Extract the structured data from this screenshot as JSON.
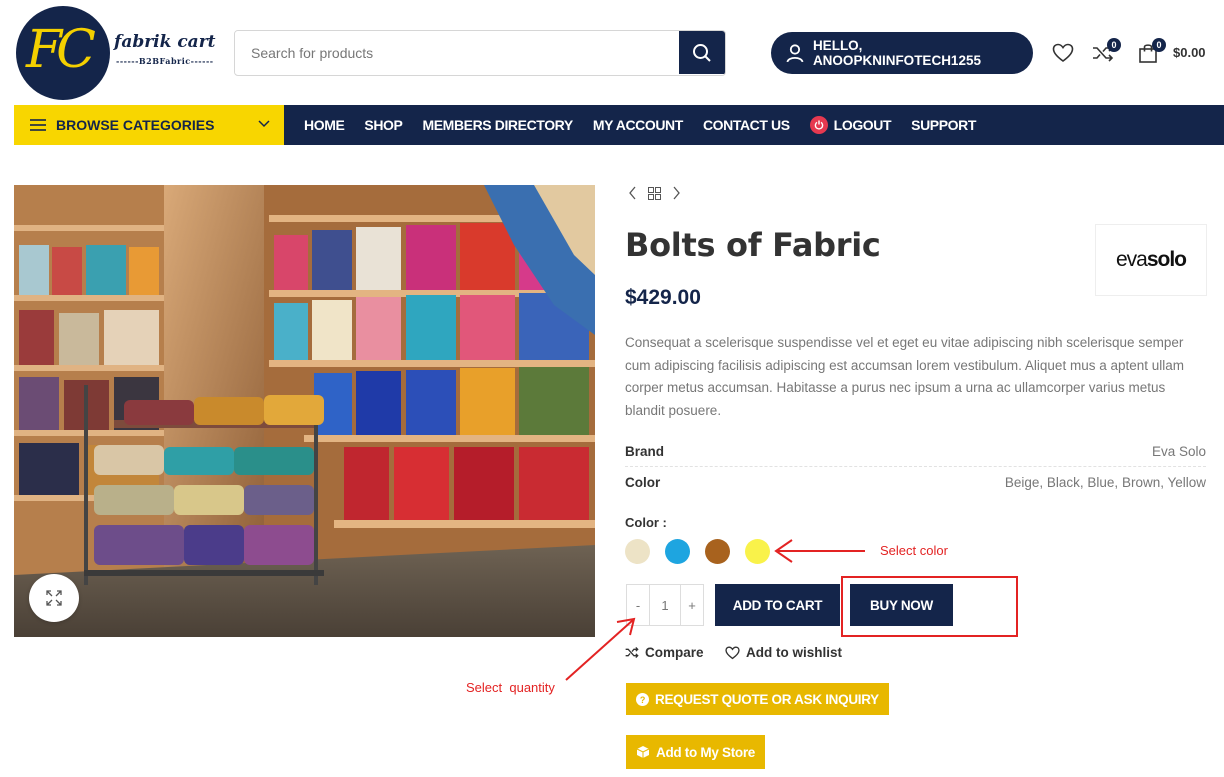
{
  "header": {
    "logo_initials": "FC",
    "logo_name": "fabrik cart",
    "logo_tagline": "------B2BFabric------",
    "search_placeholder": "Search for products",
    "greeting": "HELLO, ANOOPKNINFOTECH1255",
    "compare_count": "0",
    "cart_count": "0",
    "cart_total": "$0.00"
  },
  "nav": {
    "browse_label": "BROWSE CATEGORIES",
    "items": [
      "HOME",
      "SHOP",
      "MEMBERS DIRECTORY",
      "MY ACCOUNT",
      "CONTACT US",
      "LOGOUT",
      "SUPPORT"
    ]
  },
  "product": {
    "title": "Bolts of Fabric",
    "brand_logo": {
      "light": "eva",
      "bold": "solo"
    },
    "price": "$429.00",
    "description": "Consequat a scelerisque suspendisse vel et eget eu vitae adipiscing nibh scelerisque semper cum adipiscing facilisis adipiscing est accumsan lorem vestibulum. Aliquet mus a aptent ullam corper metus accumsan. Habitasse a purus nec ipsum a urna ac ullamcorper varius metus blandit posuere.",
    "attributes": [
      {
        "key": "Brand",
        "value": "Eva Solo"
      },
      {
        "key": "Color",
        "value": "Beige, Black, Blue, Brown, Yellow"
      }
    ],
    "color_label": "Color :",
    "swatches": [
      "#ede3c6",
      "#1ea5e0",
      "#a8621e",
      "#f9f24a"
    ],
    "quantity": {
      "minus": "-",
      "value": "1",
      "plus": "+"
    },
    "add_to_cart": "ADD TO CART",
    "buy_now": "BUY NOW",
    "compare": "Compare",
    "wishlist": "Add to wishlist",
    "request_quote": "REQUEST QUOTE OR ASK INQUIRY",
    "add_to_store": "Add to My Store"
  },
  "annotations": {
    "select_color": "Select color",
    "select_quantity": "Select  quantity"
  },
  "colors": {
    "navy": "#14254a",
    "yellow": "#f8d600",
    "gold_button": "#e8b800",
    "annotation_red": "#e32323"
  }
}
